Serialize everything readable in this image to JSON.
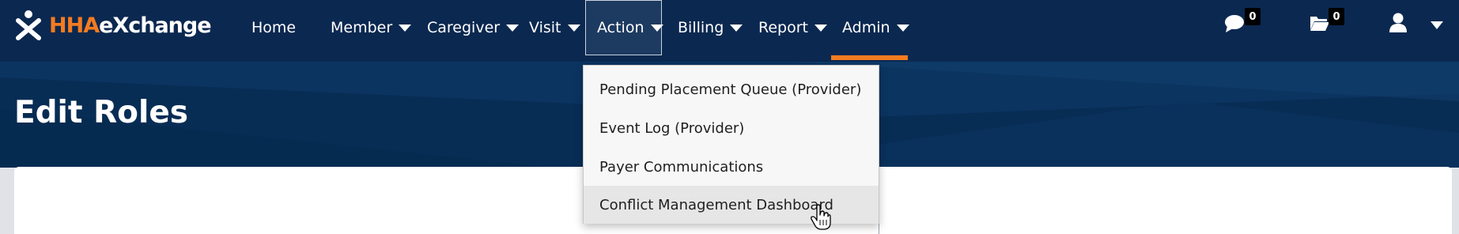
{
  "brand": {
    "logo_prefix": "HHA",
    "logo_suffix": "eXchange"
  },
  "nav": {
    "items": [
      {
        "label": "Home",
        "has_caret": false
      },
      {
        "label": "Member",
        "has_caret": true
      },
      {
        "label": "Caregiver",
        "has_caret": true
      },
      {
        "label": "Visit",
        "has_caret": true
      },
      {
        "label": "Action",
        "has_caret": true,
        "state": "open"
      },
      {
        "label": "Billing",
        "has_caret": true
      },
      {
        "label": "Report",
        "has_caret": true
      },
      {
        "label": "Admin",
        "has_caret": true,
        "state": "current-section"
      }
    ],
    "messages_count": "0",
    "files_count": "0"
  },
  "page": {
    "title": "Edit Roles"
  },
  "action_menu": {
    "items": [
      {
        "label": "Pending Placement Queue (Provider)",
        "state": "default"
      },
      {
        "label": "Event Log (Provider)",
        "state": "default"
      },
      {
        "label": "Payer Communications",
        "state": "default"
      },
      {
        "label": "Conflict Management Dashboard",
        "state": "hovered"
      }
    ]
  },
  "colors": {
    "nav_bg": "#0b2850",
    "hero_bg": "#082d55",
    "accent": "#f47b20",
    "menu_bg": "#f7f7f7",
    "menu_hover": "#e6e6e6"
  }
}
